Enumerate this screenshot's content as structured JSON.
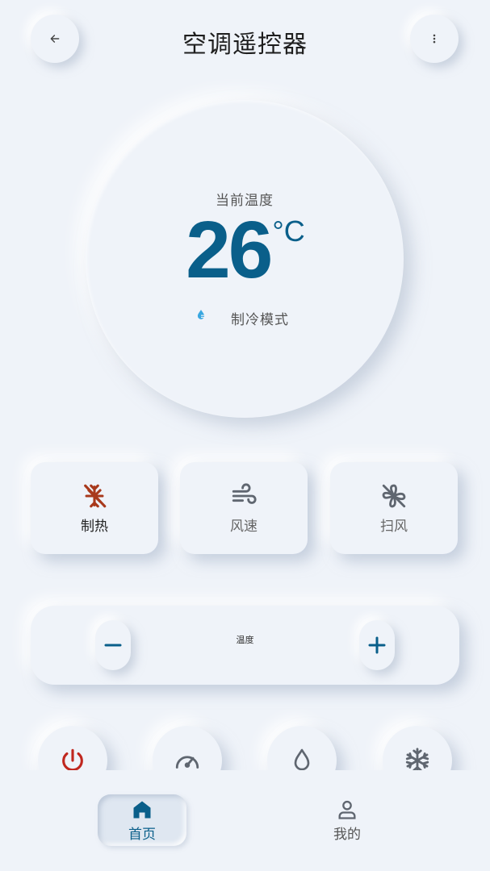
{
  "header": {
    "title": "空调遥控器",
    "back_icon": "arrow-left-icon",
    "more_icon": "more-vertical-icon"
  },
  "dial": {
    "label": "当前温度",
    "temperature": "26",
    "unit": "°C",
    "mode_icon": "water-drop-icon",
    "mode_label": "制冷模式"
  },
  "functions": [
    {
      "label": "制热",
      "icon": "heat-off-icon",
      "active": true
    },
    {
      "label": "风速",
      "icon": "wind-icon",
      "active": false
    },
    {
      "label": "扫风",
      "icon": "fan-off-icon",
      "active": false
    }
  ],
  "temp_control": {
    "label": "温度",
    "minus": "−",
    "plus": "+"
  },
  "quick_actions": [
    {
      "icon": "power-icon"
    },
    {
      "icon": "speedometer-icon"
    },
    {
      "icon": "humidity-drop-icon"
    },
    {
      "icon": "snowflake-icon"
    }
  ],
  "nav": {
    "items": [
      {
        "label": "首页",
        "icon": "home-icon",
        "selected": true
      },
      {
        "label": "我的",
        "icon": "person-icon",
        "selected": false
      }
    ]
  },
  "colors": {
    "background": "#eff3f9",
    "accent": "#0a5f8a",
    "heat": "#a8391c",
    "power": "#c0271f",
    "icon_gray": "#5f6670",
    "mode_blue": "#3aa7e0"
  }
}
